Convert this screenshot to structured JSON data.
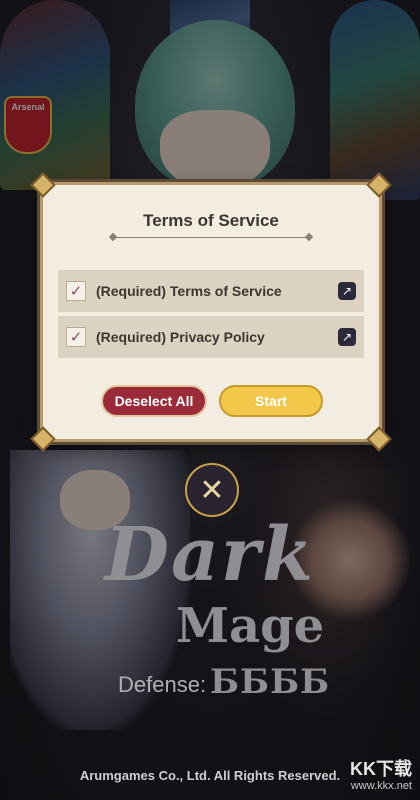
{
  "background": {
    "crest_label": "Arsenal"
  },
  "dialog": {
    "title": "Terms of Service",
    "items": [
      {
        "label": "(Required) Terms of Service",
        "checked": true,
        "icon": "external-link-icon"
      },
      {
        "label": "(Required) Privacy Policy",
        "checked": true,
        "icon": "external-link-icon"
      }
    ],
    "deselect_label": "Deselect All",
    "start_label": "Start"
  },
  "logo": {
    "line1": "Dark",
    "line2": "Mage",
    "defense": "Defense:",
    "number": "ББББ"
  },
  "footer": {
    "copyright": "Arumgames Co., Ltd. All Rights Reserved.",
    "watermark_brand": "KK下载",
    "watermark_url": "www.kkx.net"
  },
  "colors": {
    "deselect_button": "#9b2b38",
    "start_button": "#f2c84a",
    "dialog_bg": "#f2ece1"
  }
}
